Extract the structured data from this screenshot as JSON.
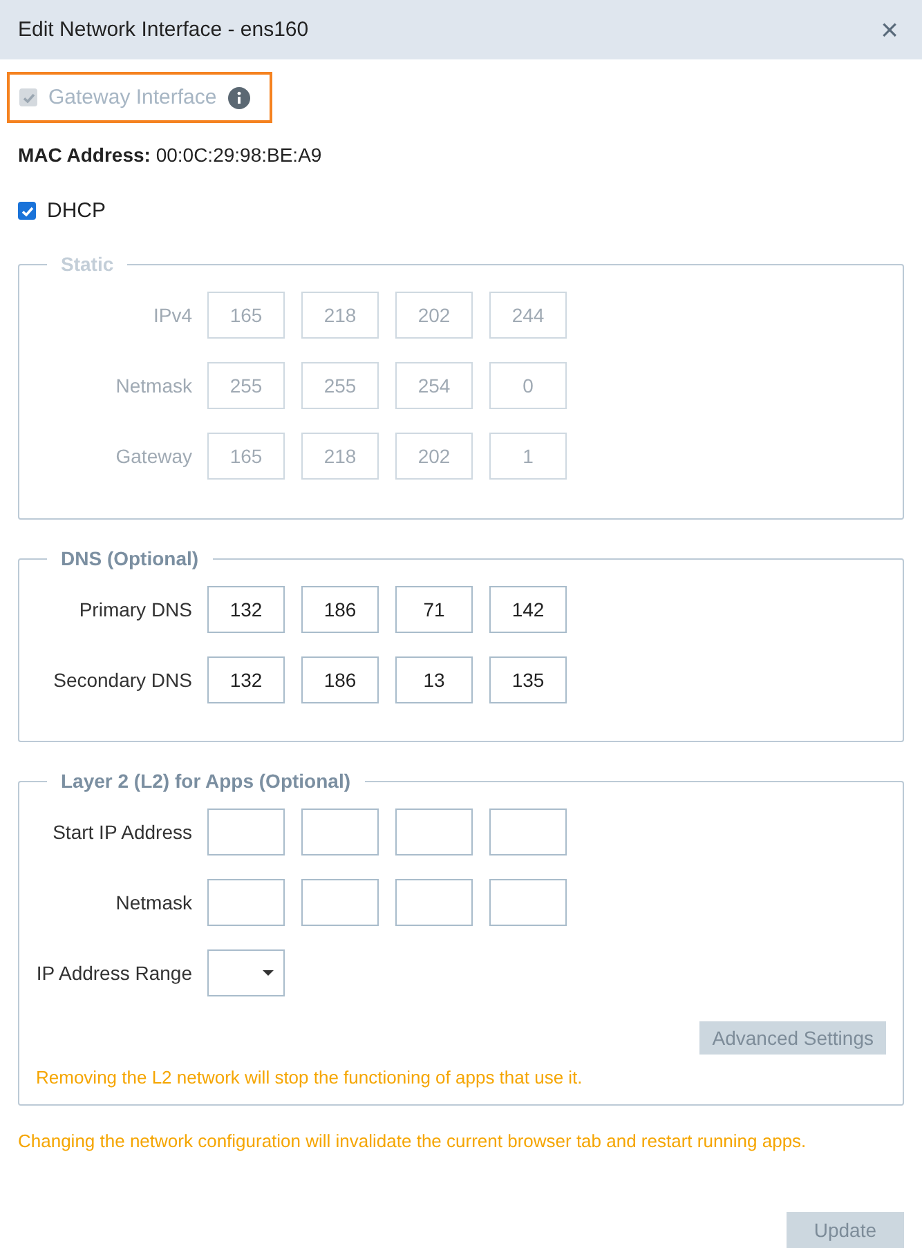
{
  "dialog": {
    "title": "Edit Network Interface - ens160",
    "close_label": "×"
  },
  "gateway_interface": {
    "label": "Gateway Interface",
    "checked": true,
    "disabled": true,
    "highlighted": true
  },
  "mac_address": {
    "label": "MAC Address:",
    "value": "00:0C:29:98:BE:A9"
  },
  "dhcp": {
    "label": "DHCP",
    "checked": true,
    "disabled": false
  },
  "sections": [
    {
      "legend": "Static",
      "disabled": true,
      "rows": [
        {
          "kind": "octets",
          "label": "IPv4",
          "values": [
            "165",
            "218",
            "202",
            "244"
          ]
        },
        {
          "kind": "octets",
          "label": "Netmask",
          "values": [
            "255",
            "255",
            "254",
            "0"
          ]
        },
        {
          "kind": "octets",
          "label": "Gateway",
          "values": [
            "165",
            "218",
            "202",
            "1"
          ]
        }
      ]
    },
    {
      "legend": "DNS (Optional)",
      "disabled": false,
      "rows": [
        {
          "kind": "octets",
          "label": "Primary DNS",
          "values": [
            "132",
            "186",
            "71",
            "142"
          ]
        },
        {
          "kind": "octets",
          "label": "Secondary DNS",
          "values": [
            "132",
            "186",
            "13",
            "135"
          ]
        }
      ]
    },
    {
      "legend": "Layer 2 (L2) for Apps (Optional)",
      "disabled": false,
      "rows": [
        {
          "kind": "empty_octets",
          "label": "Start IP Address"
        },
        {
          "kind": "empty_octets",
          "label": "Netmask"
        },
        {
          "kind": "dropdown",
          "label": "IP Address Range"
        }
      ],
      "button": {
        "label": "Advanced Settings",
        "disabled": true
      },
      "warning": "Removing the L2 network will stop the functioning of apps that use it."
    }
  ],
  "footer_warning": "Changing the network configuration will invalidate the current browser tab and restart running apps.",
  "update_button": {
    "label": "Update",
    "disabled": true
  }
}
